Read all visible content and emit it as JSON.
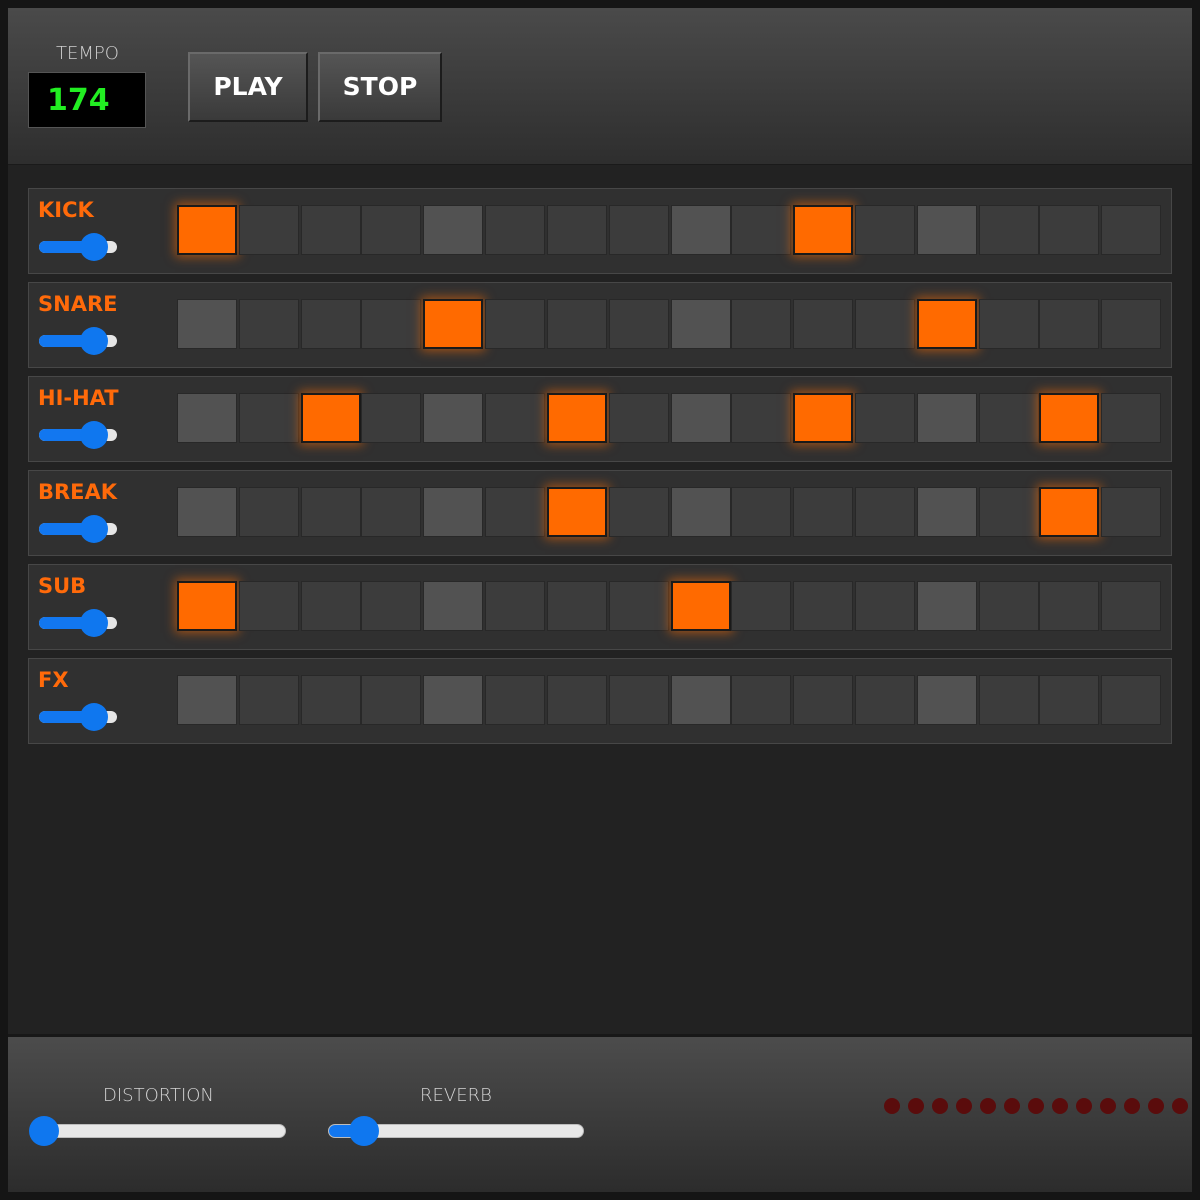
{
  "header": {
    "tempo_label": "TEMPO",
    "tempo_value": "174",
    "play_label": "PLAY",
    "stop_label": "STOP"
  },
  "tracks": [
    {
      "name": "KICK",
      "volume": 0.7,
      "steps": [
        1,
        0,
        0,
        0,
        0,
        0,
        0,
        0,
        0,
        0,
        1,
        0,
        0,
        0,
        0,
        0
      ]
    },
    {
      "name": "SNARE",
      "volume": 0.7,
      "steps": [
        0,
        0,
        0,
        0,
        1,
        0,
        0,
        0,
        0,
        0,
        0,
        0,
        1,
        0,
        0,
        0
      ]
    },
    {
      "name": "HI-HAT",
      "volume": 0.7,
      "steps": [
        0,
        0,
        1,
        0,
        0,
        0,
        1,
        0,
        0,
        0,
        1,
        0,
        0,
        0,
        1,
        0
      ]
    },
    {
      "name": "BREAK",
      "volume": 0.7,
      "steps": [
        0,
        0,
        0,
        0,
        0,
        0,
        1,
        0,
        0,
        0,
        0,
        0,
        0,
        0,
        1,
        0
      ]
    },
    {
      "name": "SUB",
      "volume": 0.7,
      "steps": [
        1,
        0,
        0,
        0,
        0,
        0,
        0,
        0,
        1,
        0,
        0,
        0,
        0,
        0,
        0,
        0
      ]
    },
    {
      "name": "FX",
      "volume": 0.7,
      "steps": [
        0,
        0,
        0,
        0,
        0,
        0,
        0,
        0,
        0,
        0,
        0,
        0,
        0,
        0,
        0,
        0
      ]
    }
  ],
  "effects": {
    "distortion_label": "DISTORTION",
    "distortion_value": 0.0,
    "reverb_label": "REVERB",
    "reverb_value": 0.14
  },
  "step_indicator": {
    "count": 13,
    "active_index": -1
  },
  "colors": {
    "accent": "#ff6a00",
    "track_label": "#ff6a0a",
    "tempo_text": "#22ee22",
    "slider": "#1277f0",
    "led_off": "#5a0c0c"
  }
}
